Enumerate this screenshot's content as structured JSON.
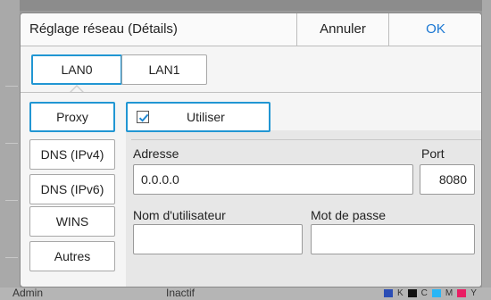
{
  "dialog": {
    "title": "Réglage réseau (Détails)",
    "cancel_label": "Annuler",
    "ok_label": "OK"
  },
  "tabs": [
    {
      "label": "LAN0",
      "selected": true
    },
    {
      "label": "LAN1",
      "selected": false
    }
  ],
  "categories": [
    {
      "label": "Proxy",
      "selected": true
    },
    {
      "label": "DNS (IPv4)",
      "selected": false
    },
    {
      "label": "DNS (IPv6)",
      "selected": false
    },
    {
      "label": "WINS",
      "selected": false
    },
    {
      "label": "Autres",
      "selected": false
    }
  ],
  "proxy": {
    "use_label": "Utiliser",
    "use_checked": true,
    "address_label": "Adresse",
    "address_value": "0.0.0.0",
    "port_label": "Port",
    "port_value": "8080",
    "username_label": "Nom d'utilisateur",
    "username_value": "",
    "password_label": "Mot de passe",
    "password_value": ""
  },
  "background": {
    "user_label": "Admin",
    "state_label": "Inactif",
    "ink_labels": [
      "K",
      "C",
      "M",
      "Y"
    ]
  },
  "colors": {
    "accent": "#2196d3",
    "ok_text": "#1976d2"
  }
}
